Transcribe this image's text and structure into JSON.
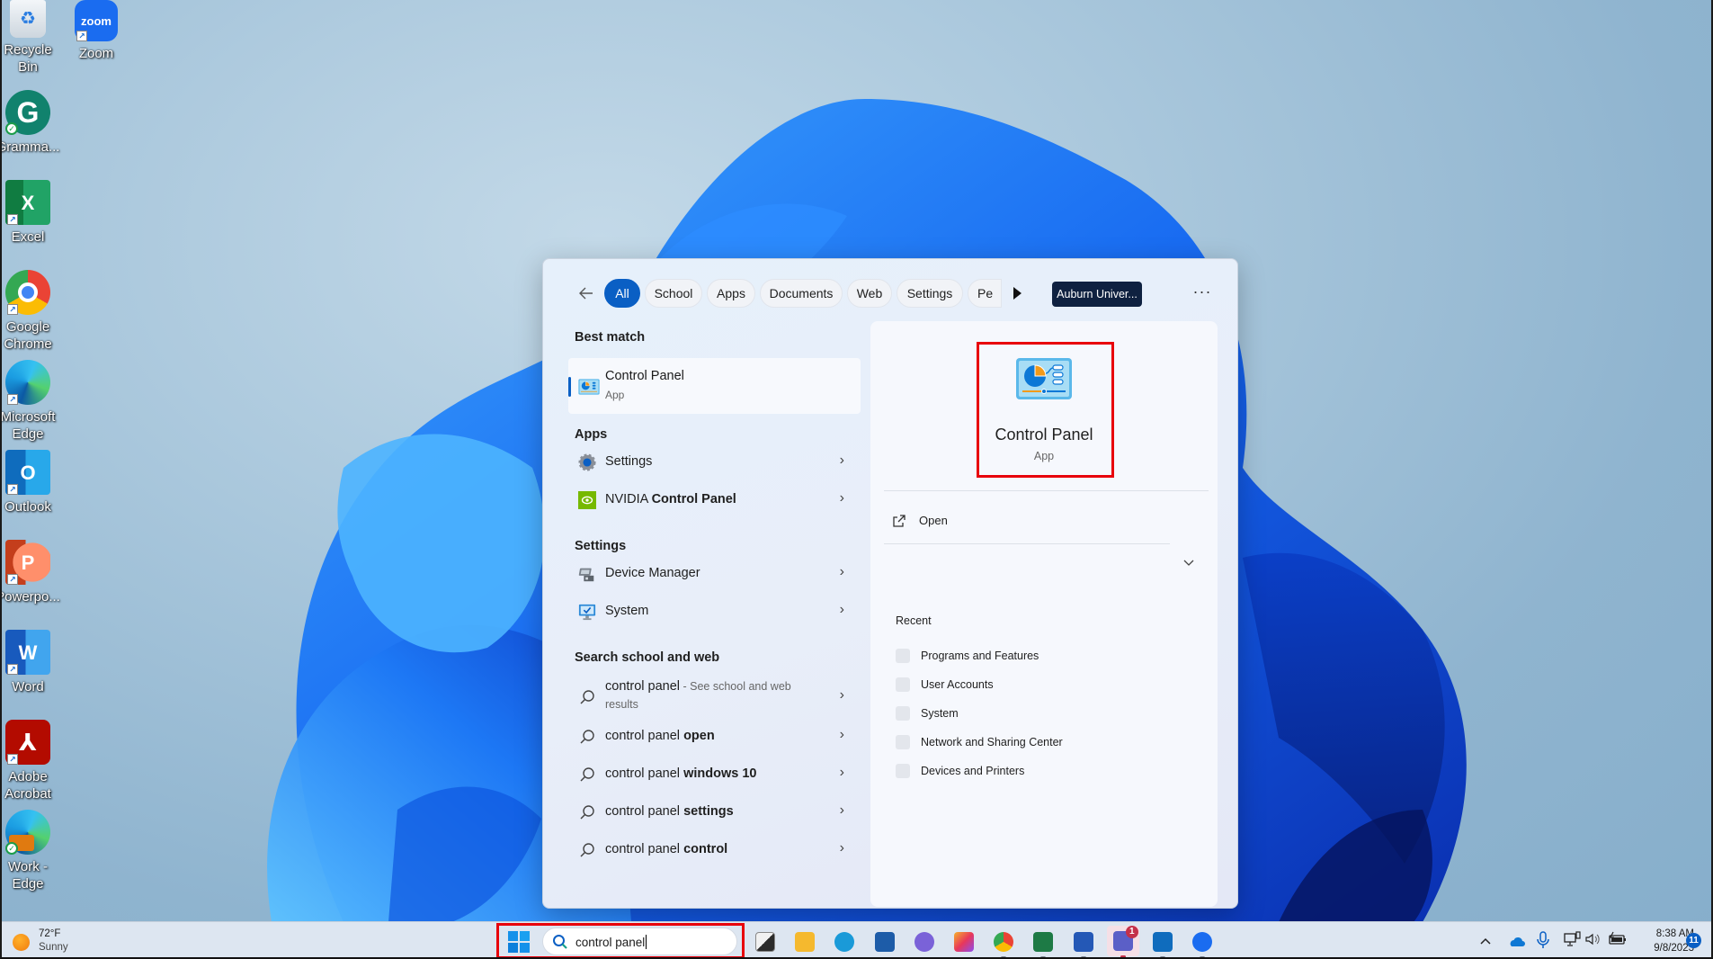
{
  "desktop": {
    "icons": [
      {
        "label": "Recycle Bin",
        "icon": "recycle-bin-icon"
      },
      {
        "label": "Zoom",
        "icon": "zoom-icon"
      },
      {
        "label": "Gramma...",
        "icon": "grammarly-icon"
      },
      {
        "label": "Excel",
        "icon": "excel-icon"
      },
      {
        "label": "Google Chrome",
        "icon": "chrome-icon"
      },
      {
        "label": "Microsoft Edge",
        "icon": "edge-icon"
      },
      {
        "label": "Outlook",
        "icon": "outlook-icon"
      },
      {
        "label": "Powerpo...",
        "icon": "powerpoint-icon"
      },
      {
        "label": "Word",
        "icon": "word-icon"
      },
      {
        "label": "Adobe Acrobat",
        "icon": "acrobat-icon"
      },
      {
        "label": "Work - Edge",
        "icon": "work-edge-icon"
      }
    ],
    "zoom_glyph_text": "zoom"
  },
  "search_panel": {
    "filters": [
      {
        "label": "All",
        "active": true
      },
      {
        "label": "School"
      },
      {
        "label": "Apps"
      },
      {
        "label": "Documents"
      },
      {
        "label": "Web"
      },
      {
        "label": "Settings"
      },
      {
        "label": "Pe"
      }
    ],
    "tenant_button": "Auburn Univer...",
    "more_label": "···",
    "best_match": {
      "heading": "Best match",
      "title": "Control Panel",
      "subtitle": "App"
    },
    "apps": {
      "heading": "Apps",
      "items": [
        {
          "label": "Settings",
          "icon": "settings-gear-icon"
        },
        {
          "label_plain": "NVIDIA ",
          "label_bold": "Control Panel",
          "icon": "nvidia-icon"
        }
      ]
    },
    "settings": {
      "heading": "Settings",
      "items": [
        {
          "label": "Device Manager",
          "icon": "device-manager-icon"
        },
        {
          "label": "System",
          "icon": "system-monitor-icon"
        }
      ]
    },
    "web": {
      "heading": "Search school and web",
      "items": [
        {
          "plain": "control panel",
          "muted": " - See school and web",
          "muted2": "results"
        },
        {
          "plain": "control panel ",
          "bold": "open"
        },
        {
          "plain": "control panel ",
          "bold": "windows 10"
        },
        {
          "plain": "control panel ",
          "bold": "settings"
        },
        {
          "plain": "control panel ",
          "bold": "control"
        }
      ]
    },
    "detail": {
      "title": "Control Panel",
      "subtitle": "App",
      "open_label": "Open",
      "recent_heading": "Recent",
      "recent": [
        "Programs and Features",
        "User Accounts",
        "System",
        "Network and Sharing Center",
        "Devices and Printers"
      ]
    }
  },
  "taskbar": {
    "weather": {
      "temp": "72°F",
      "condition": "Sunny"
    },
    "search_value": "control panel",
    "apps": [
      {
        "name": "task-view",
        "color": "#2b2b2b"
      },
      {
        "name": "file-explorer",
        "color": "#f5b92e"
      },
      {
        "name": "edge-work",
        "color": "#1a9ad8"
      },
      {
        "name": "microsoft-store",
        "color": "#1d5ca8"
      },
      {
        "name": "copilot-m365",
        "color": "#7a62d8"
      },
      {
        "name": "creative-cloud",
        "color": "#e8375a"
      },
      {
        "name": "chrome",
        "color": "#e34133"
      },
      {
        "name": "excel",
        "color": "#1d7a45"
      },
      {
        "name": "word",
        "color": "#2458b6"
      },
      {
        "name": "teams",
        "color": "#5b5fc7",
        "badge": "1"
      },
      {
        "name": "outlook",
        "color": "#0f6cbd"
      },
      {
        "name": "zoom",
        "color": "#1a6cf0"
      }
    ],
    "clock_time": "8:38 AM",
    "clock_date": "9/8/2023",
    "notification_count": "11"
  }
}
